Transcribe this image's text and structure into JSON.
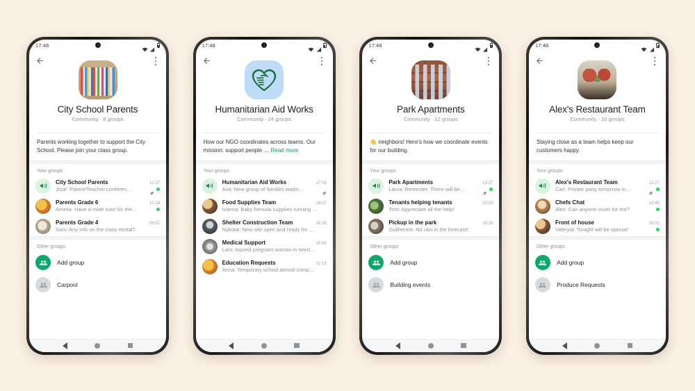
{
  "background_color": "#FBF0E4",
  "accent_green": "#11A66D",
  "unread_green": "#25D366",
  "link_green": "#1F8A6D",
  "labels": {
    "your_groups": "Your groups",
    "other_groups": "Other groups",
    "read_more": "Read more"
  },
  "phones": [
    {
      "status": {
        "time": "17:48",
        "icons": [
          "wifi-icon",
          "signal-icon",
          "battery-icon"
        ]
      },
      "appbar": {
        "back": "back-arrow-icon",
        "menu": "overflow-menu-icon"
      },
      "community": {
        "title": "City School Parents",
        "subtitle": "Community · 8 groups",
        "description": "Parents working together to support the City School. Please join your class group.",
        "has_read_more": false,
        "avatar_kind": "ph-books"
      },
      "your_groups": [
        {
          "name": "City School Parents",
          "time": "12:37",
          "message": "José: Parent/Teacher conferen…",
          "avatar": "announce",
          "pinned": true,
          "unread": true
        },
        {
          "name": "Parents Grade 6",
          "time": "10:18",
          "message": "Amelia: Have a math tutor for the…",
          "avatar": "ph-d",
          "pinned": false,
          "unread": true
        },
        {
          "name": "Parents Grade 4",
          "time": "08:52",
          "message": "Sam: Any info on the class recital?",
          "avatar": "ph-c",
          "pinned": false,
          "unread": false
        }
      ],
      "other_groups": [
        {
          "label": "Add group",
          "icon": "add-group-icon",
          "kind": "add"
        },
        {
          "label": "Carpool",
          "icon": "group-icon",
          "kind": "plain"
        }
      ],
      "navbar": [
        "back-nav-icon",
        "home-nav-icon",
        "recents-nav-icon"
      ]
    },
    {
      "status": {
        "time": "17:48",
        "icons": [
          "wifi-icon",
          "signal-icon",
          "battery-icon"
        ]
      },
      "appbar": {
        "back": "back-arrow-icon",
        "menu": "overflow-menu-icon"
      },
      "community": {
        "title": "Humanitarian Aid Works",
        "subtitle": "Community · 24 groups",
        "description": "How our NGO coordinates across teams. Our mission: support people …",
        "has_read_more": true,
        "avatar_kind": "ph-heartbg"
      },
      "your_groups": [
        {
          "name": "Humanitarian Aid Works",
          "time": "17:06",
          "message": "Ava: New group of families waitin…",
          "avatar": "announce",
          "pinned": true,
          "unread": false
        },
        {
          "name": "Food Supplies Team",
          "time": "18:37",
          "message": "Ivanna: Baby formula supplies running …",
          "avatar": "ph-a",
          "pinned": false,
          "unread": false
        },
        {
          "name": "Shelter Construction Team",
          "time": "16:35",
          "message": "Nykolai: New site open and ready for …",
          "avatar": "ph-b",
          "pinned": false,
          "unread": false
        },
        {
          "name": "Medical Support",
          "time": "15:59",
          "message": "Lars: Injured pregnant woman in need…",
          "avatar": "ph-f",
          "pinned": false,
          "unread": false
        },
        {
          "name": "Education Requests",
          "time": "12:13",
          "message": "Anna: Temporary school almost comp…",
          "avatar": "ph-d",
          "pinned": false,
          "unread": false
        }
      ],
      "other_groups": [],
      "navbar": [
        "back-nav-icon",
        "home-nav-icon",
        "recents-nav-icon"
      ]
    },
    {
      "status": {
        "time": "17:48",
        "icons": [
          "wifi-icon",
          "signal-icon",
          "battery-icon"
        ]
      },
      "appbar": {
        "back": "back-arrow-icon",
        "menu": "overflow-menu-icon"
      },
      "community": {
        "title": "Park Apartments",
        "subtitle": "Community · 12 groups",
        "description": "👋 neighbors! Here's how we coordinate events for our building.",
        "has_read_more": false,
        "avatar_kind": "ph-building"
      },
      "your_groups": [
        {
          "name": "Park Apartments",
          "time": "13:37",
          "message": "Laura: Reminder: There will be…",
          "avatar": "announce",
          "pinned": true,
          "unread": true
        },
        {
          "name": "Tenants helping tenants",
          "time": "20:03",
          "message": "Tom: Appreciate all the help!",
          "avatar": "ph-e",
          "pinned": false,
          "unread": false
        },
        {
          "name": "Pickup in the park",
          "time": "18:18",
          "message": "Guilherme: No rain in the forecast!",
          "avatar": "ph-h",
          "pinned": false,
          "unread": false
        }
      ],
      "other_groups": [
        {
          "label": "Add group",
          "icon": "add-group-icon",
          "kind": "add"
        },
        {
          "label": "Building events",
          "icon": "group-icon",
          "kind": "plain"
        }
      ],
      "navbar": [
        "back-nav-icon",
        "home-nav-icon",
        "recents-nav-icon"
      ]
    },
    {
      "status": {
        "time": "17:48",
        "icons": [
          "wifi-icon",
          "signal-icon",
          "battery-icon"
        ]
      },
      "appbar": {
        "back": "back-arrow-icon",
        "menu": "overflow-menu-icon"
      },
      "community": {
        "title": "Alex's Restaurant Team",
        "subtitle": "Community · 10 groups",
        "description": "Staying close as a team helps keep our customers happy.",
        "has_read_more": false,
        "avatar_kind": "ph-food"
      },
      "your_groups": [
        {
          "name": "Alex's Restaurant Team",
          "time": "12:27",
          "message": "Carl: Private party tomorrow in…",
          "avatar": "announce",
          "pinned": true,
          "unread": true
        },
        {
          "name": "Chefs Chat",
          "time": "10:45",
          "message": "Alex: Can anyone cover for me?",
          "avatar": "ph-g",
          "pinned": false,
          "unread": true
        },
        {
          "name": "Front of house",
          "time": "09:21",
          "message": "Valeryia: Tonight will be special!",
          "avatar": "ph-a",
          "pinned": false,
          "unread": true
        }
      ],
      "other_groups": [
        {
          "label": "Add group",
          "icon": "add-group-icon",
          "kind": "add"
        },
        {
          "label": "Produce Requests",
          "icon": "group-icon",
          "kind": "plain"
        }
      ],
      "navbar": [
        "back-nav-icon",
        "home-nav-icon",
        "recents-nav-icon"
      ]
    }
  ]
}
